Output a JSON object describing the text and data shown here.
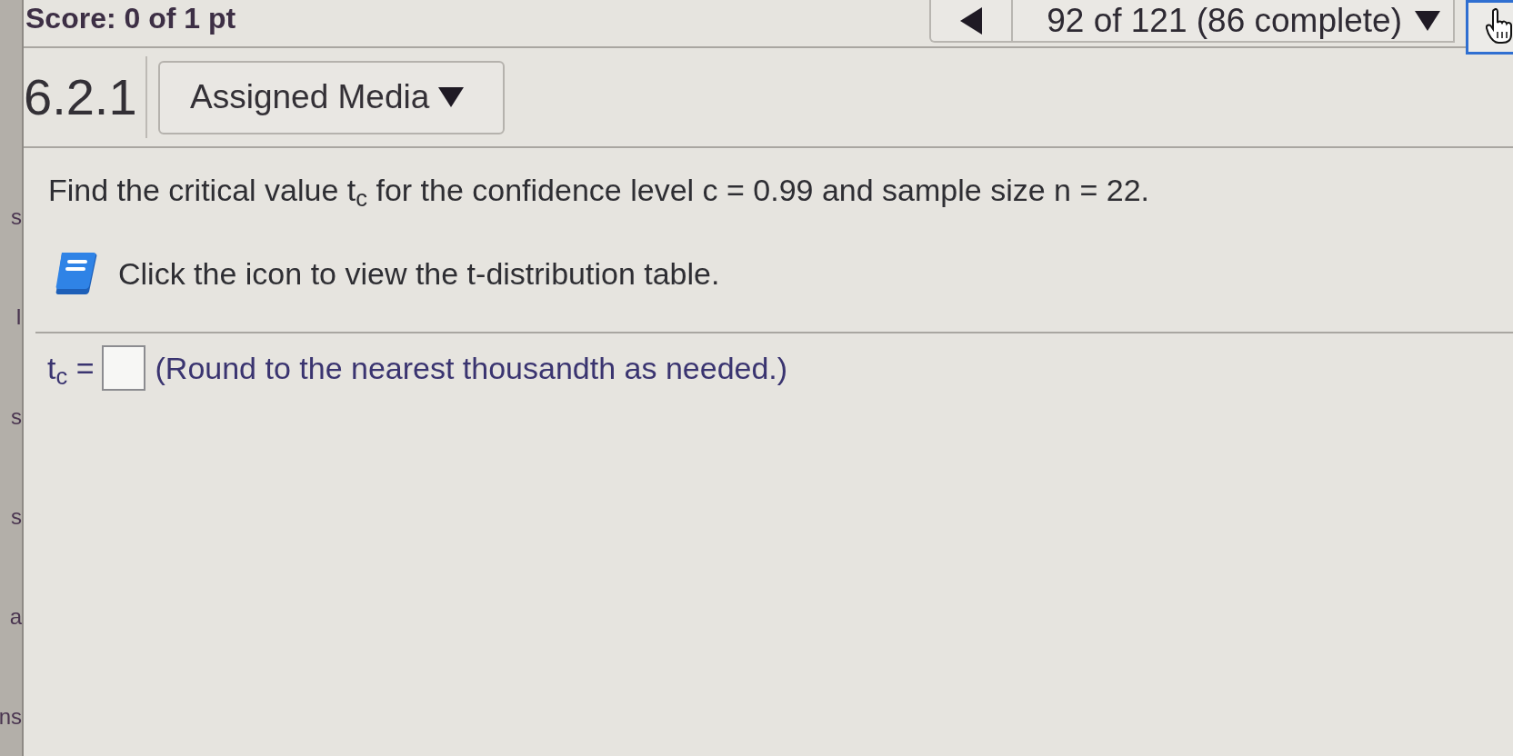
{
  "sidebar": {
    "fragments": [
      "s",
      "I",
      "s",
      "s",
      "a",
      "ns"
    ]
  },
  "header": {
    "score": "Score: 0 of 1 pt",
    "navigator": {
      "position": "92 of 121 (86 complete)"
    }
  },
  "question": {
    "number": "6.2.1",
    "media_button": "Assigned Media",
    "prompt": "Find the critical value t$_{c}$ for the confidence level c = 0.99 and sample size n = 22.",
    "table_hint": "Click the icon to view the t-distribution table.",
    "answer": {
      "label": "t$_{c}$ =",
      "note": "(Round to the nearest thousandth as needed.)"
    }
  }
}
